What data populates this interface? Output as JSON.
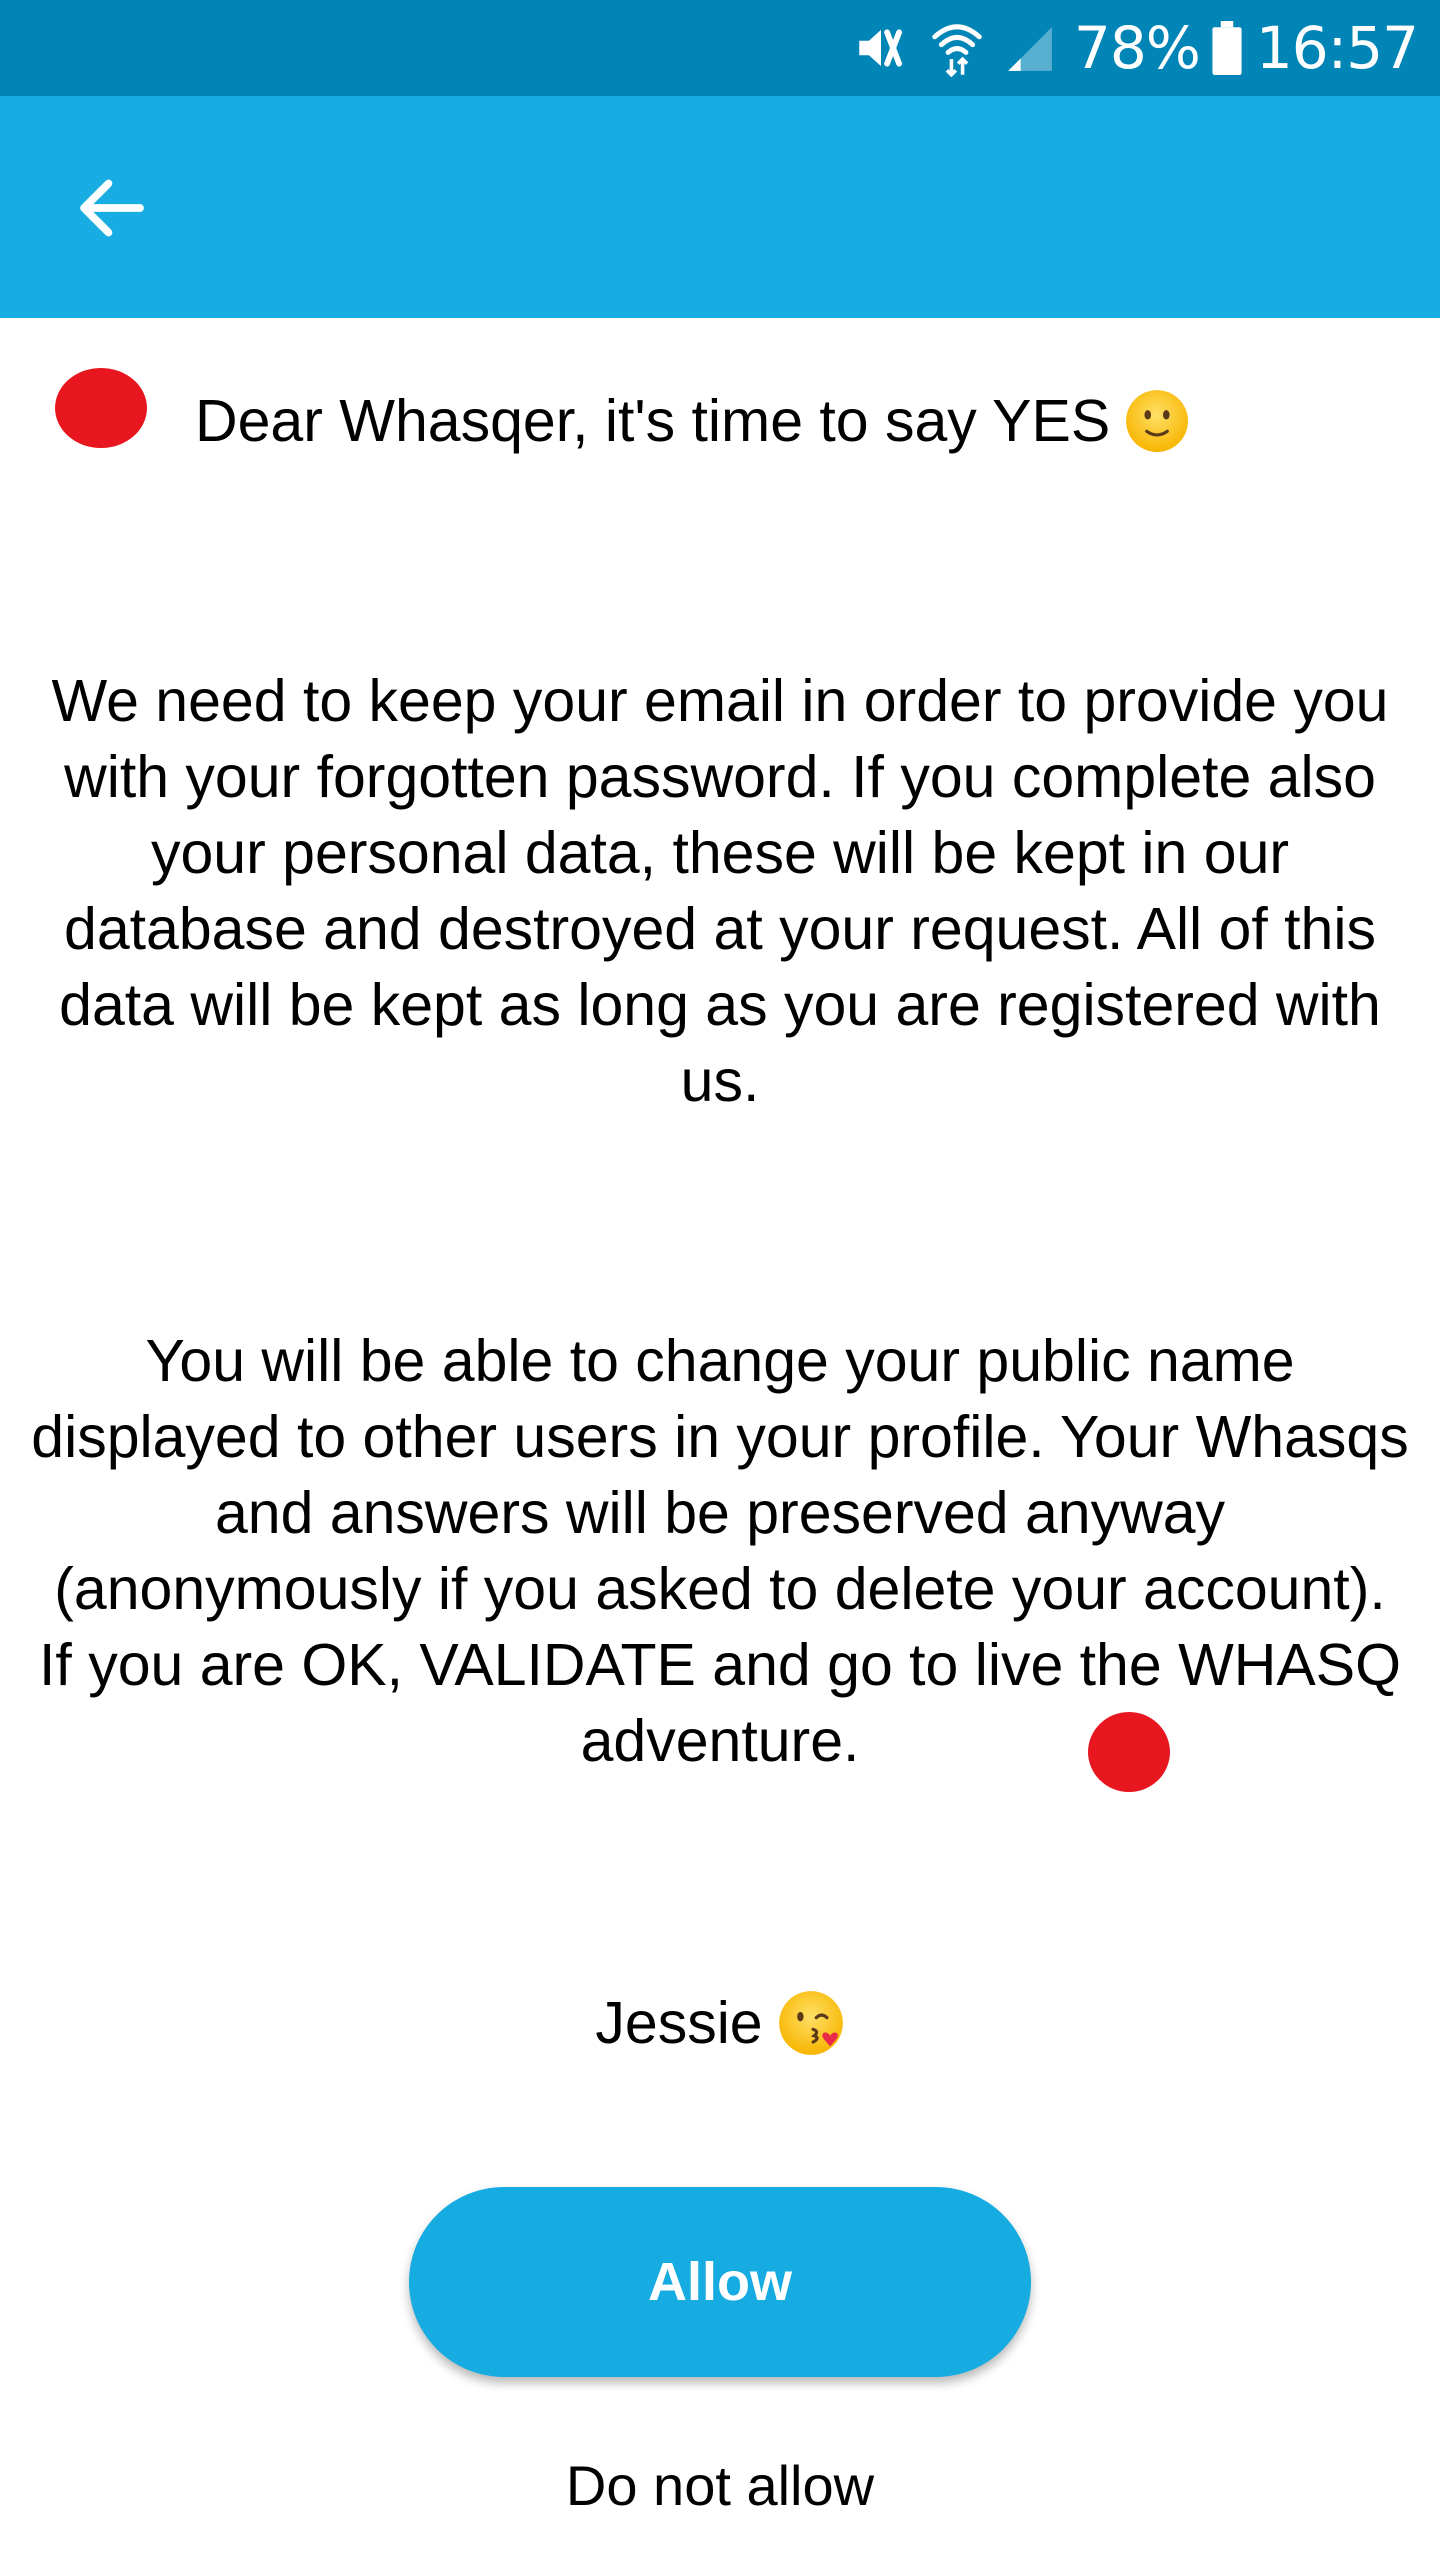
{
  "status_bar": {
    "icons": [
      "mute-icon",
      "wifi-icon",
      "signal-icon",
      "battery-icon"
    ],
    "battery_percent": "78%",
    "time": "16:57",
    "background_color": "#0185b6"
  },
  "app_bar": {
    "back_icon": "arrow-left-icon",
    "background_color": "#17ade2"
  },
  "content": {
    "greeting": "Dear Whasqer, it's time to say YES",
    "greeting_emoji": "slightly-smiling-face",
    "paragraph_1": "We need to keep your email in order to provide you with your forgotten password. If you complete also your personal data, these will be kept in our database and destroyed at your request. All of this data will be kept as long as you are registered with us.",
    "paragraph_2": "You will be able to change your public name displayed to other users in your profile. Your Whasqs and answers will be preserved anyway (anonymously if you asked to delete your account). If you are OK, VALIDATE and go to live the WHASQ adventure.",
    "signature": "Jessie",
    "signature_emoji": "face-blowing-kiss",
    "marker_color": "#e8161f"
  },
  "actions": {
    "allow_label": "Allow",
    "deny_label": "Do not allow",
    "allow_color": "#16ace1"
  }
}
